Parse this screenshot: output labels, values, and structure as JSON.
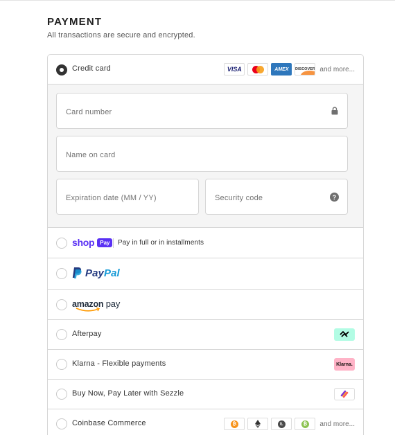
{
  "header": {
    "title": "PAYMENT",
    "subtitle": "All transactions are secure and encrypted."
  },
  "credit_card": {
    "label": "Credit card",
    "selected": true,
    "logos": [
      {
        "name": "visa-logo",
        "text": "VISA"
      },
      {
        "name": "mastercard-logo",
        "text": ""
      },
      {
        "name": "amex-logo",
        "text": "AMEX"
      },
      {
        "name": "discover-logo",
        "text": "DISCOVER"
      }
    ],
    "more_label": "and more...",
    "fields": {
      "card_number_placeholder": "Card number",
      "name_placeholder": "Name on card",
      "expiration_placeholder": "Expiration date (MM / YY)",
      "security_placeholder": "Security code",
      "help_glyph": "?"
    }
  },
  "methods": {
    "shop_pay": {
      "brand_shop": "shop",
      "brand_pay": "Pay",
      "note": "Pay in full or in installments"
    },
    "paypal": {
      "brand_pay": "Pay",
      "brand_pal": "Pal"
    },
    "amazon_pay": {
      "brand_amazon": "amazon",
      "brand_pay": " pay"
    },
    "afterpay": {
      "label": "Afterpay"
    },
    "klarna": {
      "label": "Klarna - Flexible payments",
      "badge": "Klarna."
    },
    "sezzle": {
      "label": "Buy Now, Pay Later with Sezzle"
    },
    "coinbase": {
      "label": "Coinbase Commerce",
      "more_label": "and more...",
      "coins": [
        "bitcoin-icon",
        "ethereum-icon",
        "litecoin-icon",
        "bitcoin-cash-icon"
      ]
    }
  },
  "colors": {
    "shop_purple": "#5a31f4",
    "paypal_dark": "#253b80",
    "paypal_light": "#179bd7",
    "afterpay_mint": "#b2fce4",
    "klarna_pink": "#ffb3c7",
    "amex_blue": "#2e77bc"
  }
}
